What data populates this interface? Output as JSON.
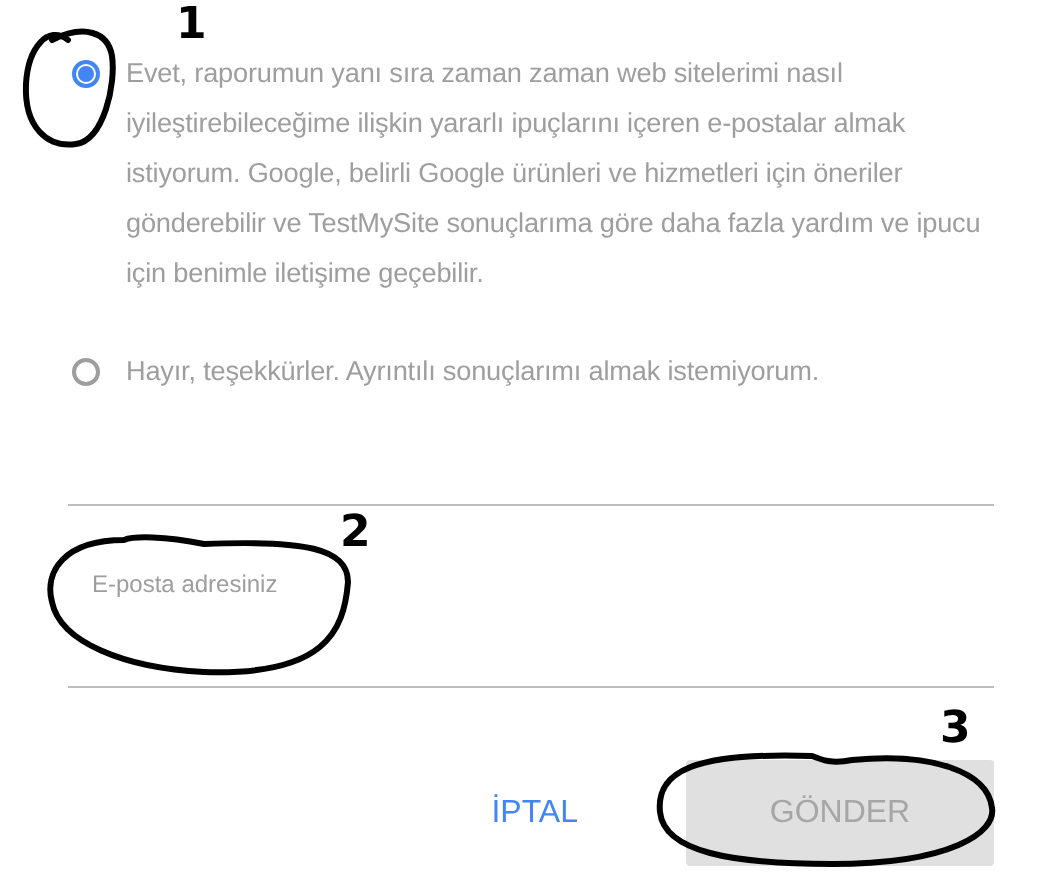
{
  "options": [
    {
      "label": "Evet, raporumun yanı sıra zaman zaman web sitelerimi nasıl iyileştirebileceğime ilişkin yararlı ipuçlarını içeren e-postalar almak istiyorum. Google, belirli Google ürünleri ve hizmetleri için öneriler gönderebilir ve TestMySite sonuçlarıma göre daha fazla yardım ve ipucu için benimle iletişime geçebilir.",
      "selected": true
    },
    {
      "label": "Hayır, teşekkürler. Ayrıntılı sonuçlarımı almak istemiyorum.",
      "selected": false
    }
  ],
  "email_field": {
    "placeholder": "E-posta adresiniz"
  },
  "buttons": [
    {
      "label": "İPTAL",
      "kind": "text",
      "disabled": false
    },
    {
      "label": "GÖNDER",
      "kind": "raised",
      "disabled": true
    }
  ],
  "annotations": [
    {
      "label": "1"
    },
    {
      "label": "2"
    },
    {
      "label": "3"
    }
  ]
}
